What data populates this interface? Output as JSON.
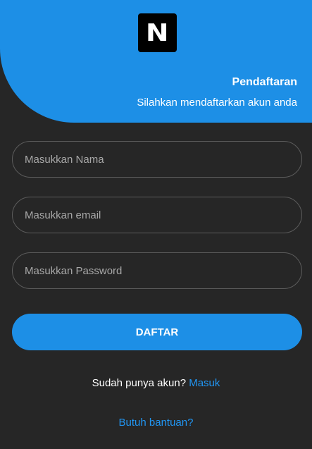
{
  "brand": {
    "logo_letter": "N",
    "logo_bg_color": "#000000",
    "accent_color": "#1d8fe6"
  },
  "header": {
    "title": "Pendaftaran",
    "subtitle": "Silahkan mendaftarkan akun anda"
  },
  "form": {
    "name_placeholder": "Masukkan Nama",
    "email_placeholder": "Masukkan email",
    "password_placeholder": "Masukkan Password",
    "submit_label": "DAFTAR"
  },
  "footer": {
    "login_prompt": "Sudah punya akun?",
    "login_link": "Masuk",
    "help_link": "Butuh bantuan?"
  }
}
